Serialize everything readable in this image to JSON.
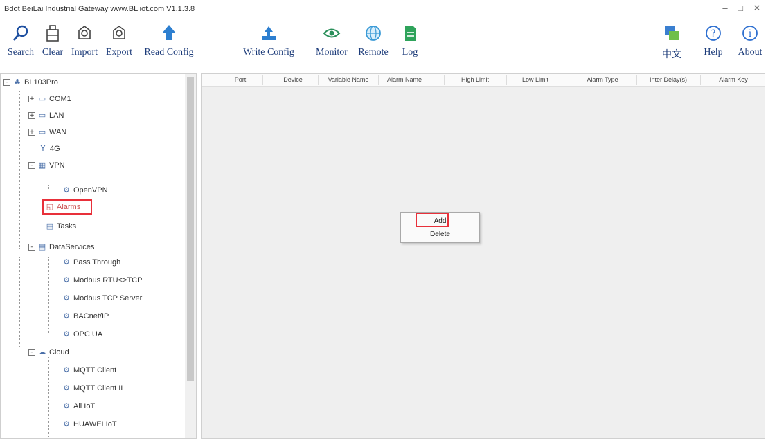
{
  "window": {
    "title": "Bdot BeiLai Industrial Gateway www.BLiiot.com V1.1.3.8",
    "controls": [
      "–",
      "□",
      "✕"
    ]
  },
  "toolbar": {
    "left": [
      {
        "label": "Search",
        "icon": "search-icon"
      },
      {
        "label": "Clear",
        "icon": "clear-icon"
      },
      {
        "label": "Import",
        "icon": "import-icon"
      },
      {
        "label": "Export",
        "icon": "export-icon"
      },
      {
        "label": "Read Config",
        "icon": "read-config-icon"
      },
      {
        "label": "Write Config",
        "icon": "write-config-icon"
      },
      {
        "label": "Monitor",
        "icon": "eye-icon"
      },
      {
        "label": "Remote",
        "icon": "globe-icon"
      },
      {
        "label": "Log",
        "icon": "log-icon"
      }
    ],
    "right": [
      {
        "label": "中文",
        "icon": "language-icon"
      },
      {
        "label": "Help",
        "icon": "help-icon"
      },
      {
        "label": "About",
        "icon": "info-icon"
      }
    ]
  },
  "tree": {
    "root": "BL103Pro",
    "items": [
      {
        "label": "COM1",
        "toggle": "+"
      },
      {
        "label": "LAN",
        "toggle": "+"
      },
      {
        "label": "WAN",
        "toggle": "+"
      },
      {
        "label": "4G",
        "toggle": ""
      },
      {
        "label": "VPN",
        "toggle": "-"
      },
      {
        "label": "OpenVPN",
        "toggle": ""
      },
      {
        "label": "Alarms",
        "toggle": ""
      },
      {
        "label": "Tasks",
        "toggle": ""
      },
      {
        "label": "DataServices",
        "toggle": "-"
      },
      {
        "label": "Pass Through",
        "toggle": ""
      },
      {
        "label": "Modbus RTU<>TCP",
        "toggle": ""
      },
      {
        "label": "Modbus TCP Server",
        "toggle": ""
      },
      {
        "label": "BACnet/IP",
        "toggle": ""
      },
      {
        "label": "OPC UA",
        "toggle": ""
      },
      {
        "label": "Cloud",
        "toggle": "-"
      },
      {
        "label": "MQTT Client",
        "toggle": ""
      },
      {
        "label": "MQTT Client II",
        "toggle": ""
      },
      {
        "label": "Ali IoT",
        "toggle": ""
      },
      {
        "label": "HUAWEI IoT",
        "toggle": ""
      }
    ]
  },
  "grid": {
    "columns": [
      "Port",
      "Device",
      "Variable Name",
      "Alarm Name",
      "High Limit",
      "Low Limit",
      "Alarm Type",
      "Inter Delay(s)",
      "Alarm Key"
    ]
  },
  "context_menu": {
    "items": [
      "Add",
      "Delete"
    ]
  },
  "colors": {
    "highlight": "#e8303a",
    "toolbar_text": "#1d3c7a",
    "grid_bg": "#efefef"
  }
}
